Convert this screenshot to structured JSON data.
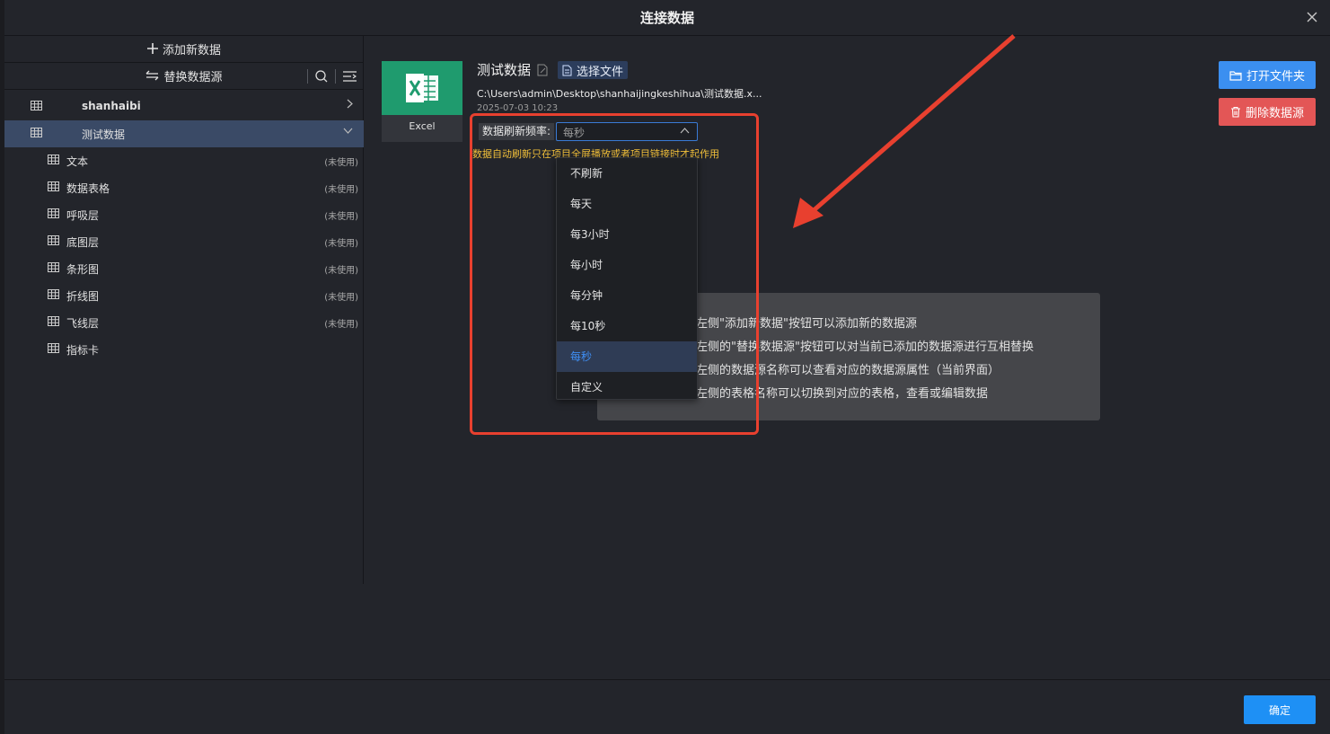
{
  "dialog": {
    "title": "连接数据"
  },
  "sidebar": {
    "add_label": "添加新数据",
    "replace_label": "替换数据源",
    "groups": [
      {
        "label": "shanhaibi"
      },
      {
        "label": "测试数据"
      }
    ],
    "items": [
      {
        "label": "文本",
        "tag": "(未使用)"
      },
      {
        "label": "数据表格",
        "tag": "(未使用)"
      },
      {
        "label": "呼吸层",
        "tag": "(未使用)"
      },
      {
        "label": "底图层",
        "tag": "(未使用)"
      },
      {
        "label": "条形图",
        "tag": "(未使用)"
      },
      {
        "label": "折线图",
        "tag": "(未使用)"
      },
      {
        "label": "飞线层",
        "tag": "(未使用)"
      },
      {
        "label": "指标卡",
        "tag": ""
      }
    ]
  },
  "datasource": {
    "type_label": "Excel",
    "name": "测试数据",
    "select_file_label": "选择文件",
    "path": "C:\\Users\\admin\\Desktop\\shanhaijingkeshihua\\测试数据.x...",
    "time": "2025-07-03 10:23",
    "refresh_label": "数据刷新频率:",
    "refresh_value": "每秒",
    "refresh_note": "数据自动刷新只在项目全屏播放或者项目链接时才起作用"
  },
  "dropdown": {
    "options": [
      "不刷新",
      "每天",
      "每3小时",
      "每小时",
      "每分钟",
      "每10秒",
      "每秒",
      "自定义"
    ],
    "selected": "每秒"
  },
  "info": {
    "lines": [
      "左侧\"添加新数据\"按钮可以添加新的数据源",
      "左侧的\"替换数据源\"按钮可以对当前已添加的数据源进行互相替换",
      "左侧的数据源名称可以查看对应的数据源属性（当前界面）",
      "左侧的表格名称可以切换到对应的表格，查看或编辑数据"
    ]
  },
  "actions": {
    "open_folder_label": "打开文件夹",
    "delete_label": "删除数据源",
    "ok_label": "确定"
  },
  "colors": {
    "accent": "#1e90f5",
    "danger": "#e35656",
    "excel": "#1f9b6e",
    "annotation": "#e8402f",
    "note": "#f2c03a"
  }
}
